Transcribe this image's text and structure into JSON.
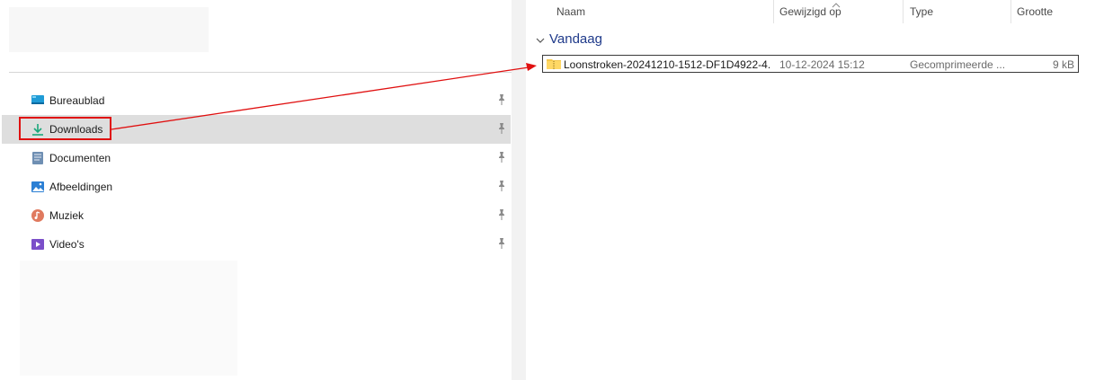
{
  "sidebar": {
    "items": [
      {
        "label": "Bureaublad",
        "icon": "desktop-icon"
      },
      {
        "label": "Downloads",
        "icon": "download-icon",
        "selected": true
      },
      {
        "label": "Documenten",
        "icon": "documents-icon"
      },
      {
        "label": "Afbeeldingen",
        "icon": "pictures-icon"
      },
      {
        "label": "Muziek",
        "icon": "music-icon"
      },
      {
        "label": "Video's",
        "icon": "videos-icon"
      }
    ]
  },
  "columns": {
    "name": "Naam",
    "modified": "Gewijzigd op",
    "type": "Type",
    "size": "Grootte"
  },
  "group": {
    "label": "Vandaag"
  },
  "files": [
    {
      "name": "Loonstroken-20241210-1512-DF1D4922-4...",
      "modified": "10-12-2024 15:12",
      "type": "Gecomprimeerde ...",
      "size": "9 kB",
      "icon": "zip-folder-icon"
    }
  ],
  "colors": {
    "selection": "#dedede",
    "annotation": "#e01010",
    "group_header": "#1f3a8a"
  }
}
